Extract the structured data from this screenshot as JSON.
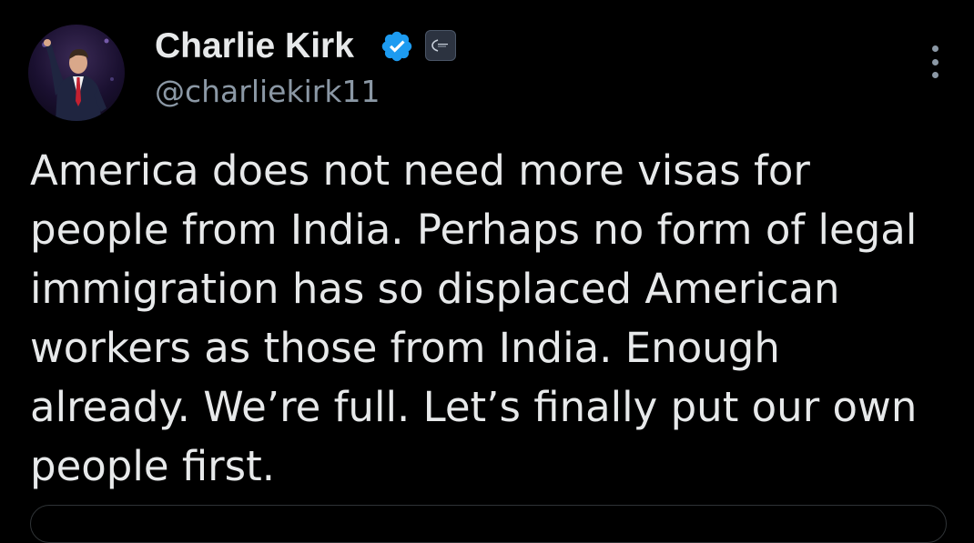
{
  "author": {
    "display_name": "Charlie Kirk",
    "handle": "@charliekirk11",
    "verified_icon": "verified-badge-icon",
    "affiliate_icon": "affiliate-badge-icon",
    "avatar": "avatar-photo"
  },
  "menu": {
    "icon": "more-options-icon"
  },
  "tweet": {
    "lines": [
      "America does not need more visas for",
      "people from India. Perhaps no form of legal",
      "immigration has so displaced American",
      "workers as those from India. Enough",
      "already. We’re full. Let’s finally put our own",
      "people first."
    ]
  },
  "colors": {
    "background": "#000000",
    "primary_text": "#e7e9ea",
    "secondary_text": "#8b98a5",
    "verified_blue": "#1d9bf0",
    "border": "#2f3336"
  }
}
